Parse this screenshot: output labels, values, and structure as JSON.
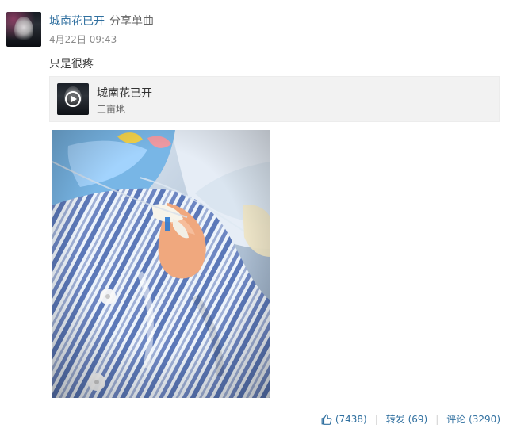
{
  "post": {
    "author": "城南花已开",
    "action": "分享单曲",
    "time": "4月22日 09:43",
    "text": "只是很疼"
  },
  "music": {
    "title": "城南花已开",
    "artist": "三亩地"
  },
  "photo": {
    "icon": "photo-icon"
  },
  "actions": {
    "like_count": "(7438)",
    "repost_label": "转发 (69)",
    "comment_label": "评论 (3290)"
  },
  "icons": {
    "avatar": "avatar",
    "play": "play-icon",
    "like": "thumbs-up-icon"
  },
  "colors": {
    "link": "#2f6f9f",
    "card_bg": "#f2f2f2",
    "muted": "#8a8a8a",
    "separator": "#d0d0d0"
  }
}
